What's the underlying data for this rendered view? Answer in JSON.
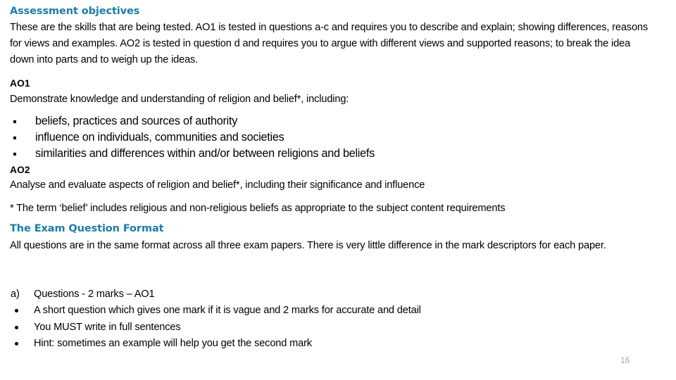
{
  "slide": {
    "page_number": "16",
    "accent_color": "#1C7CA8",
    "background_color": "#FFFFFF",
    "text_color": "#000000",
    "page_number_color": "#A6A6A6"
  },
  "assessment_objectives": {
    "heading": "Assessment objectives",
    "intro": "These are the skills that are being tested.  AO1 is tested in questions a-c and requires you to describe and explain; showing differences, reasons for views and examples.  AO2 is tested in question d and requires you to argue with different views and supported reasons; to break the idea down into parts and to weigh up the ideas."
  },
  "ao1": {
    "label": "AO1",
    "description": "Demonstrate knowledge and understanding of religion and belief*, including:",
    "bullets": [
      "beliefs, practices and sources of authority",
      "influence on individuals, communities and societies",
      "similarities and differences within and/or between religions and beliefs"
    ]
  },
  "ao2": {
    "label": "AO2",
    "description": "Analyse and evaluate aspects of religion and belief*, including their significance and influence"
  },
  "footnote": {
    "text": "* The term ‘belief’ includes religious and non-religious beliefs as appropriate to the subject content requirements"
  },
  "exam_format": {
    "heading": "The Exam Question Format",
    "intro": "All questions are in the same format across all three exam papers. There is very little difference in the mark descriptors for each paper.",
    "question_a": {
      "marker": "a)",
      "text": "Questions  - 2 marks – AO1"
    },
    "bullets": [
      "A short question which gives one mark if it is vague and 2 marks for accurate and detail",
      "You MUST write in full sentences",
      "Hint: sometimes an example will help you get the second mark"
    ]
  }
}
